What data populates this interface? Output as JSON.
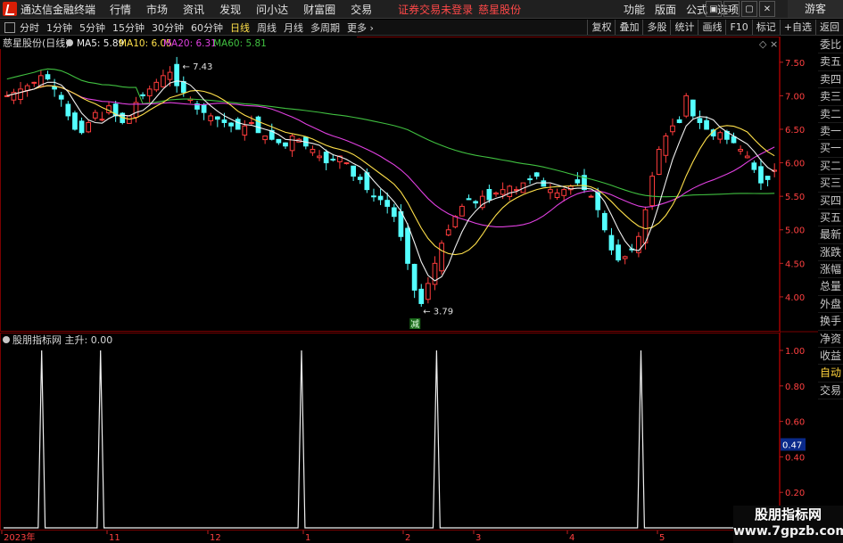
{
  "titlebar": {
    "app_title": "通达信金融终端",
    "menu": [
      "行情",
      "市场",
      "资讯",
      "发现",
      "问小达",
      "财富圈",
      "交易"
    ],
    "notice": "证券交易未登录",
    "stock_name": "慈星股份",
    "right_menu": [
      "功能",
      "版面",
      "公式",
      "选项"
    ],
    "window_buttons": [
      "▣",
      "—",
      "▢",
      "✕"
    ],
    "guest": "游客"
  },
  "toolbar": {
    "periods": [
      "分时",
      "1分钟",
      "5分钟",
      "15分钟",
      "30分钟",
      "60分钟",
      "日线",
      "周线",
      "月线",
      "多周期",
      "更多 ›"
    ],
    "active_period": "日线",
    "tools": [
      "复权",
      "叠加",
      "多股",
      "统计",
      "画线",
      "F10",
      "标记",
      "+自选",
      "返回"
    ]
  },
  "main_chart": {
    "title": "慈星股份(日线)",
    "ma_labels": [
      {
        "text": "MA5: 5.89",
        "color": "#f0f0f0"
      },
      {
        "text": "MA10: 6.05",
        "color": "#ffe04a"
      },
      {
        "text": "MA20: 6.31",
        "color": "#e040e0"
      },
      {
        "text": "MA60: 5.81",
        "color": "#40c040"
      }
    ],
    "high_label": "7.43",
    "low_label": "3.79",
    "flag": "减",
    "y_ticks": [
      "7.50",
      "7.00",
      "6.50",
      "6.00",
      "5.50",
      "5.00",
      "4.50",
      "4.00"
    ]
  },
  "sub_chart": {
    "title": "股朋指标网 主升: 0.00",
    "y_ticks": [
      "1.00",
      "0.80",
      "0.60",
      "0.40",
      "0.20"
    ],
    "cursor_value": "0.47"
  },
  "x_axis": [
    "2023年",
    "11",
    "12",
    "1",
    "2",
    "3",
    "4",
    "5"
  ],
  "sidebar": [
    "委比",
    "卖五",
    "卖四",
    "卖三",
    "卖二",
    "卖一",
    "买一",
    "买二",
    "买三",
    "买四",
    "买五",
    "最新",
    "涨跌",
    "涨幅",
    "总量",
    "外盘",
    "换手",
    "净资",
    "收益",
    "自动",
    "交易"
  ],
  "sidebar_highlight": "自动",
  "watermark": {
    "line1": "股朋指标网",
    "line2": "www.7gpzb.com"
  },
  "colors": {
    "up": "#ff3c3c",
    "down": "#54ffff",
    "ma5": "#f0f0f0",
    "ma10": "#ffe04a",
    "ma20": "#e040e0",
    "ma60": "#40c040",
    "signal": "#f0f0f0",
    "grid": "#7a0000"
  },
  "chart_data": [
    {
      "type": "candlestick",
      "title": "慈星股份(日线)",
      "ylim": [
        3.6,
        7.75
      ],
      "ma_latest": {
        "MA5": 5.89,
        "MA10": 6.05,
        "MA20": 6.31,
        "MA60": 5.81
      },
      "close_path": [
        7.0,
        7.05,
        7.1,
        7.15,
        7.2,
        7.3,
        7.25,
        7.1,
        6.95,
        6.7,
        6.5,
        6.45,
        6.6,
        6.75,
        6.65,
        6.85,
        6.7,
        6.6,
        6.7,
        6.9,
        7.0,
        7.1,
        7.2,
        7.3,
        7.35,
        7.15,
        7.05,
        6.95,
        6.8,
        6.75,
        6.7,
        6.65,
        6.6,
        6.55,
        6.5,
        6.55,
        6.6,
        6.45,
        6.4,
        6.35,
        6.3,
        6.25,
        6.4,
        6.35,
        6.25,
        6.2,
        6.1,
        6.0,
        6.05,
        6.1,
        6.0,
        5.8,
        5.75,
        5.6,
        5.5,
        5.45,
        5.35,
        5.2,
        4.9,
        4.5,
        4.1,
        3.9,
        4.2,
        4.5,
        4.8,
        5.0,
        5.2,
        5.35,
        5.45,
        5.4,
        5.5,
        5.45,
        5.55,
        5.6,
        5.65,
        5.6,
        5.7,
        5.75,
        5.8,
        5.65,
        5.6,
        5.55,
        5.6,
        5.65,
        5.7,
        5.6,
        5.5,
        5.3,
        5.0,
        4.7,
        4.55,
        4.6,
        4.7,
        4.9,
        5.3,
        5.8,
        6.2,
        6.4,
        6.55,
        6.6,
        7.0,
        6.7,
        6.6,
        6.5,
        6.4,
        6.45,
        6.35,
        6.3,
        6.2,
        6.1,
        5.9,
        5.7,
        5.75,
        5.89
      ],
      "high": 7.43,
      "low": 3.79
    },
    {
      "type": "line",
      "title": "股朋指标网 主升: 0.00",
      "ylim": [
        0,
        1.0
      ],
      "x_range": [
        0,
        111
      ],
      "spikes_at": [
        11,
        28,
        86,
        125,
        184
      ],
      "spike_value": 1.0,
      "total_points": 223
    }
  ]
}
